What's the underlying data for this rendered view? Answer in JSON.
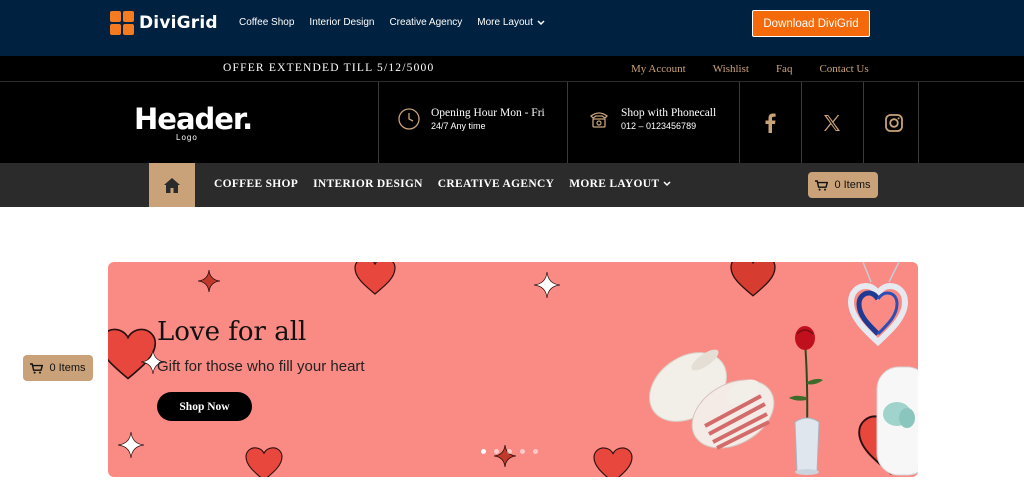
{
  "topbar": {
    "brand": "DiviGrid",
    "nav": [
      "Coffee Shop",
      "Interior Design",
      "Creative Agency",
      "More Layout"
    ],
    "download_label": "Download DiviGrid"
  },
  "offerbar": {
    "text": "OFFER EXTENDED TILL 5/12/5000",
    "links": [
      "My Account",
      "Wishlist",
      "Faq",
      "Contact Us"
    ]
  },
  "header": {
    "logo_main": "Header.",
    "logo_sub": "Logo",
    "opening": {
      "title": "Opening Hour Mon - Fri",
      "detail": "24/7 Any time",
      "icon": "clock-icon"
    },
    "phone": {
      "title": "Shop with Phonecall",
      "detail": "012 – 0123456789",
      "icon": "phone-icon"
    },
    "social": [
      "facebook-icon",
      "x-icon",
      "instagram-icon"
    ]
  },
  "navbar": {
    "items": [
      "COFFEE SHOP",
      "INTERIOR DESIGN",
      "CREATIVE AGENCY",
      "MORE LAYOUT"
    ],
    "cart_label": "0 Items"
  },
  "floating_cart": {
    "label": "0 Items"
  },
  "hero": {
    "title": "Love for all",
    "subtitle": "Gift for those who fill your heart",
    "button": "Shop Now",
    "slides": 5,
    "active_slide": 1
  },
  "colors": {
    "topbar_bg": "#00213f",
    "accent_orange": "#f46a0b",
    "gold": "#c9a27a",
    "hero_bg": "#fa8a84",
    "heart_red": "#e8473d"
  }
}
